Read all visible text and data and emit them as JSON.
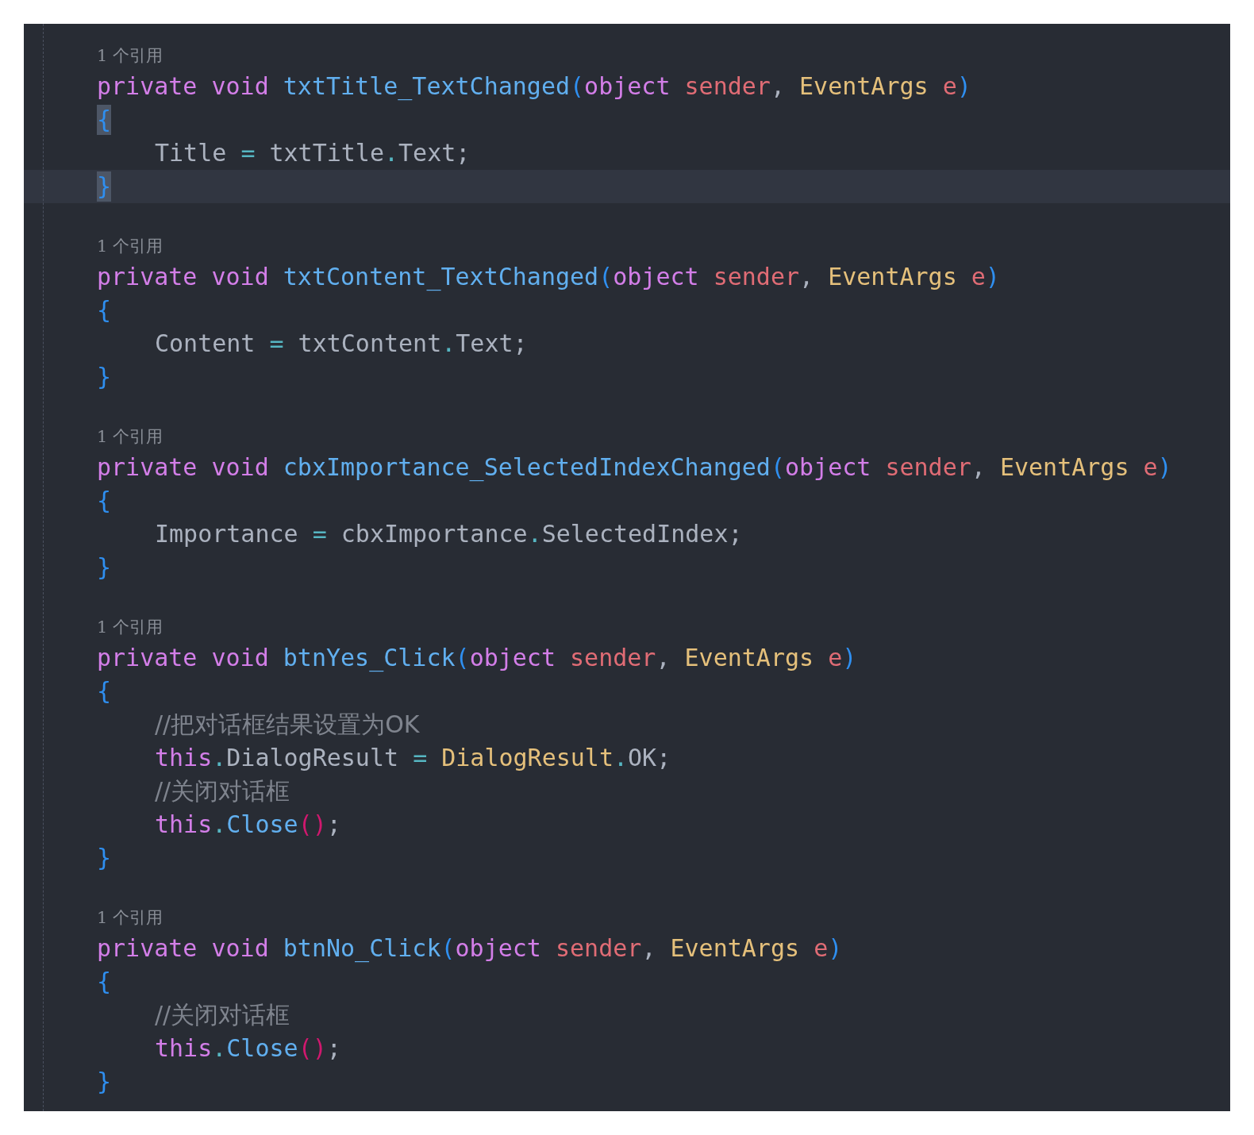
{
  "methods": [
    {
      "references": "1 个引用",
      "braces_matched": true,
      "close_line_current": true,
      "open_brace": "{",
      "close_brace": "}",
      "signature": [
        {
          "text": "private ",
          "kind": "keyword"
        },
        {
          "text": "void ",
          "kind": "keyword"
        },
        {
          "text": "txtTitle_TextChanged",
          "kind": "function"
        },
        {
          "text": "(",
          "kind": "bracket"
        },
        {
          "text": "object ",
          "kind": "keyword"
        },
        {
          "text": "sender",
          "kind": "param"
        },
        {
          "text": ", ",
          "kind": "plain"
        },
        {
          "text": "EventArgs ",
          "kind": "type"
        },
        {
          "text": "e",
          "kind": "param"
        },
        {
          "text": ")",
          "kind": "bracket"
        }
      ],
      "body": [
        [
          {
            "text": "Title ",
            "kind": "plain"
          },
          {
            "text": "=",
            "kind": "operator"
          },
          {
            "text": " txtTitle",
            "kind": "plain"
          },
          {
            "text": ".",
            "kind": "operator"
          },
          {
            "text": "Text;",
            "kind": "plain"
          }
        ]
      ]
    },
    {
      "references": "1 个引用",
      "braces_matched": false,
      "close_line_current": false,
      "open_brace": "{",
      "close_brace": "}",
      "signature": [
        {
          "text": "private ",
          "kind": "keyword"
        },
        {
          "text": "void ",
          "kind": "keyword"
        },
        {
          "text": "txtContent_TextChanged",
          "kind": "function"
        },
        {
          "text": "(",
          "kind": "bracket"
        },
        {
          "text": "object ",
          "kind": "keyword"
        },
        {
          "text": "sender",
          "kind": "param"
        },
        {
          "text": ", ",
          "kind": "plain"
        },
        {
          "text": "EventArgs ",
          "kind": "type"
        },
        {
          "text": "e",
          "kind": "param"
        },
        {
          "text": ")",
          "kind": "bracket"
        }
      ],
      "body": [
        [
          {
            "text": "Content ",
            "kind": "plain"
          },
          {
            "text": "=",
            "kind": "operator"
          },
          {
            "text": " txtContent",
            "kind": "plain"
          },
          {
            "text": ".",
            "kind": "operator"
          },
          {
            "text": "Text;",
            "kind": "plain"
          }
        ]
      ]
    },
    {
      "references": "1 个引用",
      "braces_matched": false,
      "close_line_current": false,
      "open_brace": "{",
      "close_brace": "}",
      "signature": [
        {
          "text": "private ",
          "kind": "keyword"
        },
        {
          "text": "void ",
          "kind": "keyword"
        },
        {
          "text": "cbxImportance_SelectedIndexChanged",
          "kind": "function"
        },
        {
          "text": "(",
          "kind": "bracket"
        },
        {
          "text": "object ",
          "kind": "keyword"
        },
        {
          "text": "sender",
          "kind": "param"
        },
        {
          "text": ", ",
          "kind": "plain"
        },
        {
          "text": "EventArgs ",
          "kind": "type"
        },
        {
          "text": "e",
          "kind": "param"
        },
        {
          "text": ")",
          "kind": "bracket"
        }
      ],
      "body": [
        [
          {
            "text": "Importance ",
            "kind": "plain"
          },
          {
            "text": "=",
            "kind": "operator"
          },
          {
            "text": " cbxImportance",
            "kind": "plain"
          },
          {
            "text": ".",
            "kind": "operator"
          },
          {
            "text": "SelectedIndex;",
            "kind": "plain"
          }
        ]
      ]
    },
    {
      "references": "1 个引用",
      "braces_matched": false,
      "close_line_current": false,
      "open_brace": "{",
      "close_brace": "}",
      "signature": [
        {
          "text": "private ",
          "kind": "keyword"
        },
        {
          "text": "void ",
          "kind": "keyword"
        },
        {
          "text": "btnYes_Click",
          "kind": "function"
        },
        {
          "text": "(",
          "kind": "bracket"
        },
        {
          "text": "object ",
          "kind": "keyword"
        },
        {
          "text": "sender",
          "kind": "param"
        },
        {
          "text": ", ",
          "kind": "plain"
        },
        {
          "text": "EventArgs ",
          "kind": "type"
        },
        {
          "text": "e",
          "kind": "param"
        },
        {
          "text": ")",
          "kind": "bracket"
        }
      ],
      "body": [
        [
          {
            "text": "//把对话框结果设置为OK",
            "kind": "comment"
          }
        ],
        [
          {
            "text": "this",
            "kind": "keyword"
          },
          {
            "text": ".",
            "kind": "operator"
          },
          {
            "text": "DialogResult ",
            "kind": "plain"
          },
          {
            "text": "= ",
            "kind": "operator"
          },
          {
            "text": "DialogResult",
            "kind": "type"
          },
          {
            "text": ".",
            "kind": "operator"
          },
          {
            "text": "OK;",
            "kind": "plain"
          }
        ],
        [
          {
            "text": "//关闭对话框",
            "kind": "comment"
          }
        ],
        [
          {
            "text": "this",
            "kind": "keyword"
          },
          {
            "text": ".",
            "kind": "operator"
          },
          {
            "text": "Close",
            "kind": "function"
          },
          {
            "text": "()",
            "kind": "call"
          },
          {
            "text": ";",
            "kind": "plain"
          }
        ]
      ]
    },
    {
      "references": "1 个引用",
      "braces_matched": false,
      "close_line_current": false,
      "open_brace": "{",
      "close_brace": "}",
      "signature": [
        {
          "text": "private ",
          "kind": "keyword"
        },
        {
          "text": "void ",
          "kind": "keyword"
        },
        {
          "text": "btnNo_Click",
          "kind": "function"
        },
        {
          "text": "(",
          "kind": "bracket"
        },
        {
          "text": "object ",
          "kind": "keyword"
        },
        {
          "text": "sender",
          "kind": "param"
        },
        {
          "text": ", ",
          "kind": "plain"
        },
        {
          "text": "EventArgs ",
          "kind": "type"
        },
        {
          "text": "e",
          "kind": "param"
        },
        {
          "text": ")",
          "kind": "bracket"
        }
      ],
      "body": [
        [
          {
            "text": "//关闭对话框",
            "kind": "comment"
          }
        ],
        [
          {
            "text": "this",
            "kind": "keyword"
          },
          {
            "text": ".",
            "kind": "operator"
          },
          {
            "text": "Close",
            "kind": "function"
          },
          {
            "text": "()",
            "kind": "call"
          },
          {
            "text": ";",
            "kind": "plain"
          }
        ]
      ]
    }
  ]
}
